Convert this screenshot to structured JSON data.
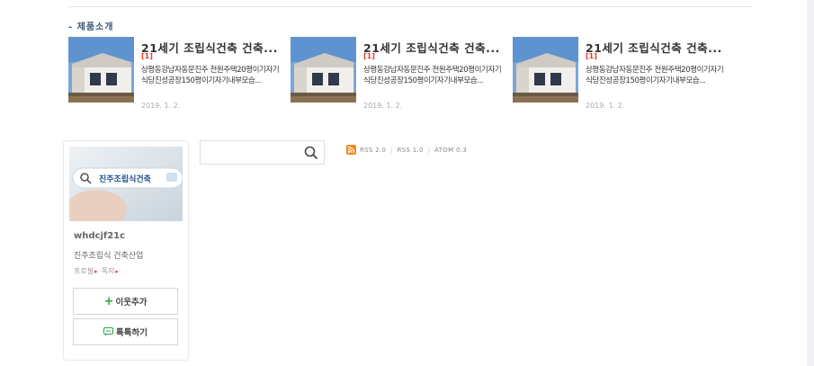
{
  "section_title": "- 제품소개",
  "products": [
    {
      "title": "21세기 조립식건축 건축...",
      "count": "[1]",
      "desc": "상평동강남자동문진주 전원주택20평이기자기식당진성공장150평이기자기내부모습...",
      "date": "2019. 1. 2."
    },
    {
      "title": "21세기 조립식건축 건축...",
      "count": "[1]",
      "desc": "상평동강남자동문진주 전원주택20평이기자기식당진성공장150평이기자기내부모습...",
      "date": "2019. 1. 2."
    },
    {
      "title": "21세기 조립식건축 건축...",
      "count": "[1]",
      "desc": "상평동강남자동문진주 전원주택20평이기자기식당진성공장150평이기자기내부모습...",
      "date": "2019. 1. 2."
    }
  ],
  "profile": {
    "avatar_text": "진주조립식건축",
    "username": "whdcjf21c",
    "blog_desc": "진주조립식 건축산업",
    "profile_link": "프로필",
    "guestbook_link": "쪽지",
    "add_neighbor": "이웃추가",
    "talk": "톡톡하기",
    "accent_color": "#25a84a"
  },
  "search": {
    "placeholder": "",
    "icon": "search-icon"
  },
  "feeds": {
    "rss2": "RSS 2.0",
    "rss1": "RSS 1.0",
    "atom": "ATOM 0.3",
    "icon": "rss-icon",
    "color": "#f08a24"
  }
}
